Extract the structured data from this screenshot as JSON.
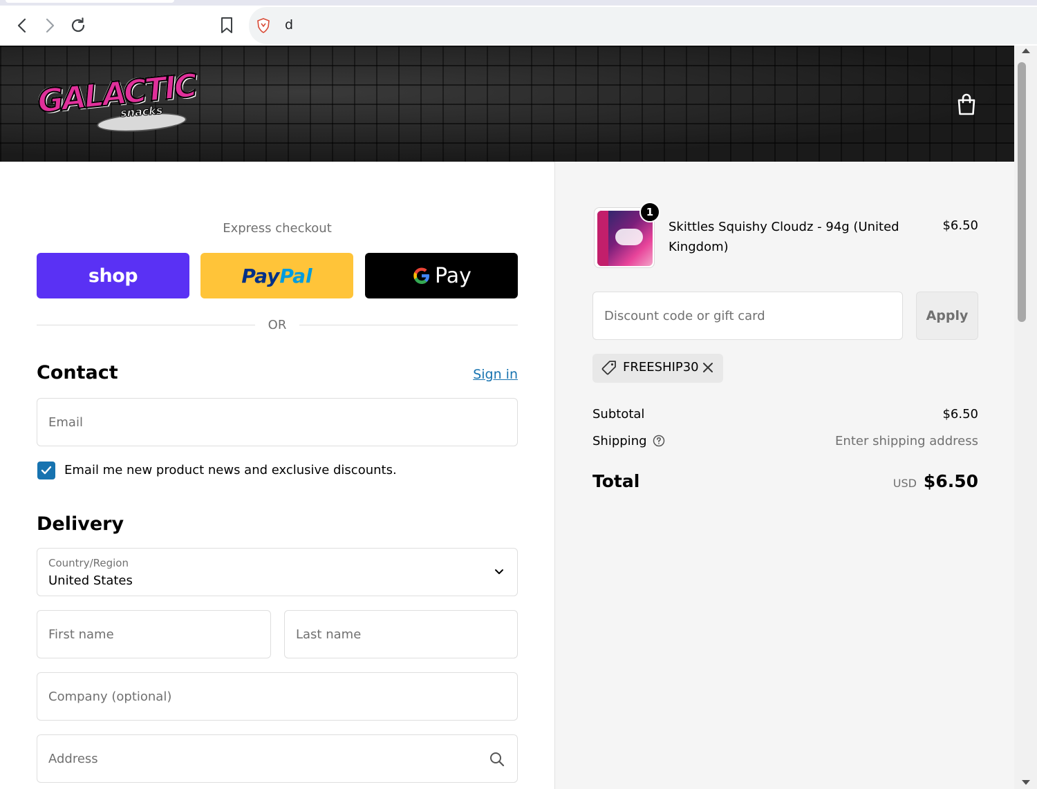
{
  "browser": {
    "url": "d"
  },
  "store": {
    "logo_main": "GALACTIC",
    "logo_sub": "snacks"
  },
  "express": {
    "label": "Express checkout",
    "shop_label": "shop",
    "paypal_part1": "Pay",
    "paypal_part2": "Pal",
    "gpay_label": "Pay",
    "or_label": "OR"
  },
  "contact": {
    "title": "Contact",
    "sign_in": "Sign in",
    "email_placeholder": "Email",
    "newsletter_label": "Email me new product news and exclusive discounts.",
    "newsletter_checked": true
  },
  "delivery": {
    "title": "Delivery",
    "country_label": "Country/Region",
    "country_value": "United States",
    "first_name_placeholder": "First name",
    "last_name_placeholder": "Last name",
    "company_placeholder": "Company (optional)",
    "address_placeholder": "Address"
  },
  "summary": {
    "item": {
      "name": "Skittles Squishy Cloudz - 94g (United Kingdom)",
      "price": "$6.50",
      "quantity": "1"
    },
    "discount_placeholder": "Discount code or gift card",
    "apply_label": "Apply",
    "applied_code": "FREESHIP30",
    "subtotal_label": "Subtotal",
    "subtotal_value": "$6.50",
    "shipping_label": "Shipping",
    "shipping_value": "Enter shipping address",
    "total_label": "Total",
    "currency": "USD",
    "total_value": "$6.50"
  },
  "colors": {
    "shop_pay": "#5a31f4",
    "paypal": "#ffc439",
    "link": "#1773b0"
  }
}
